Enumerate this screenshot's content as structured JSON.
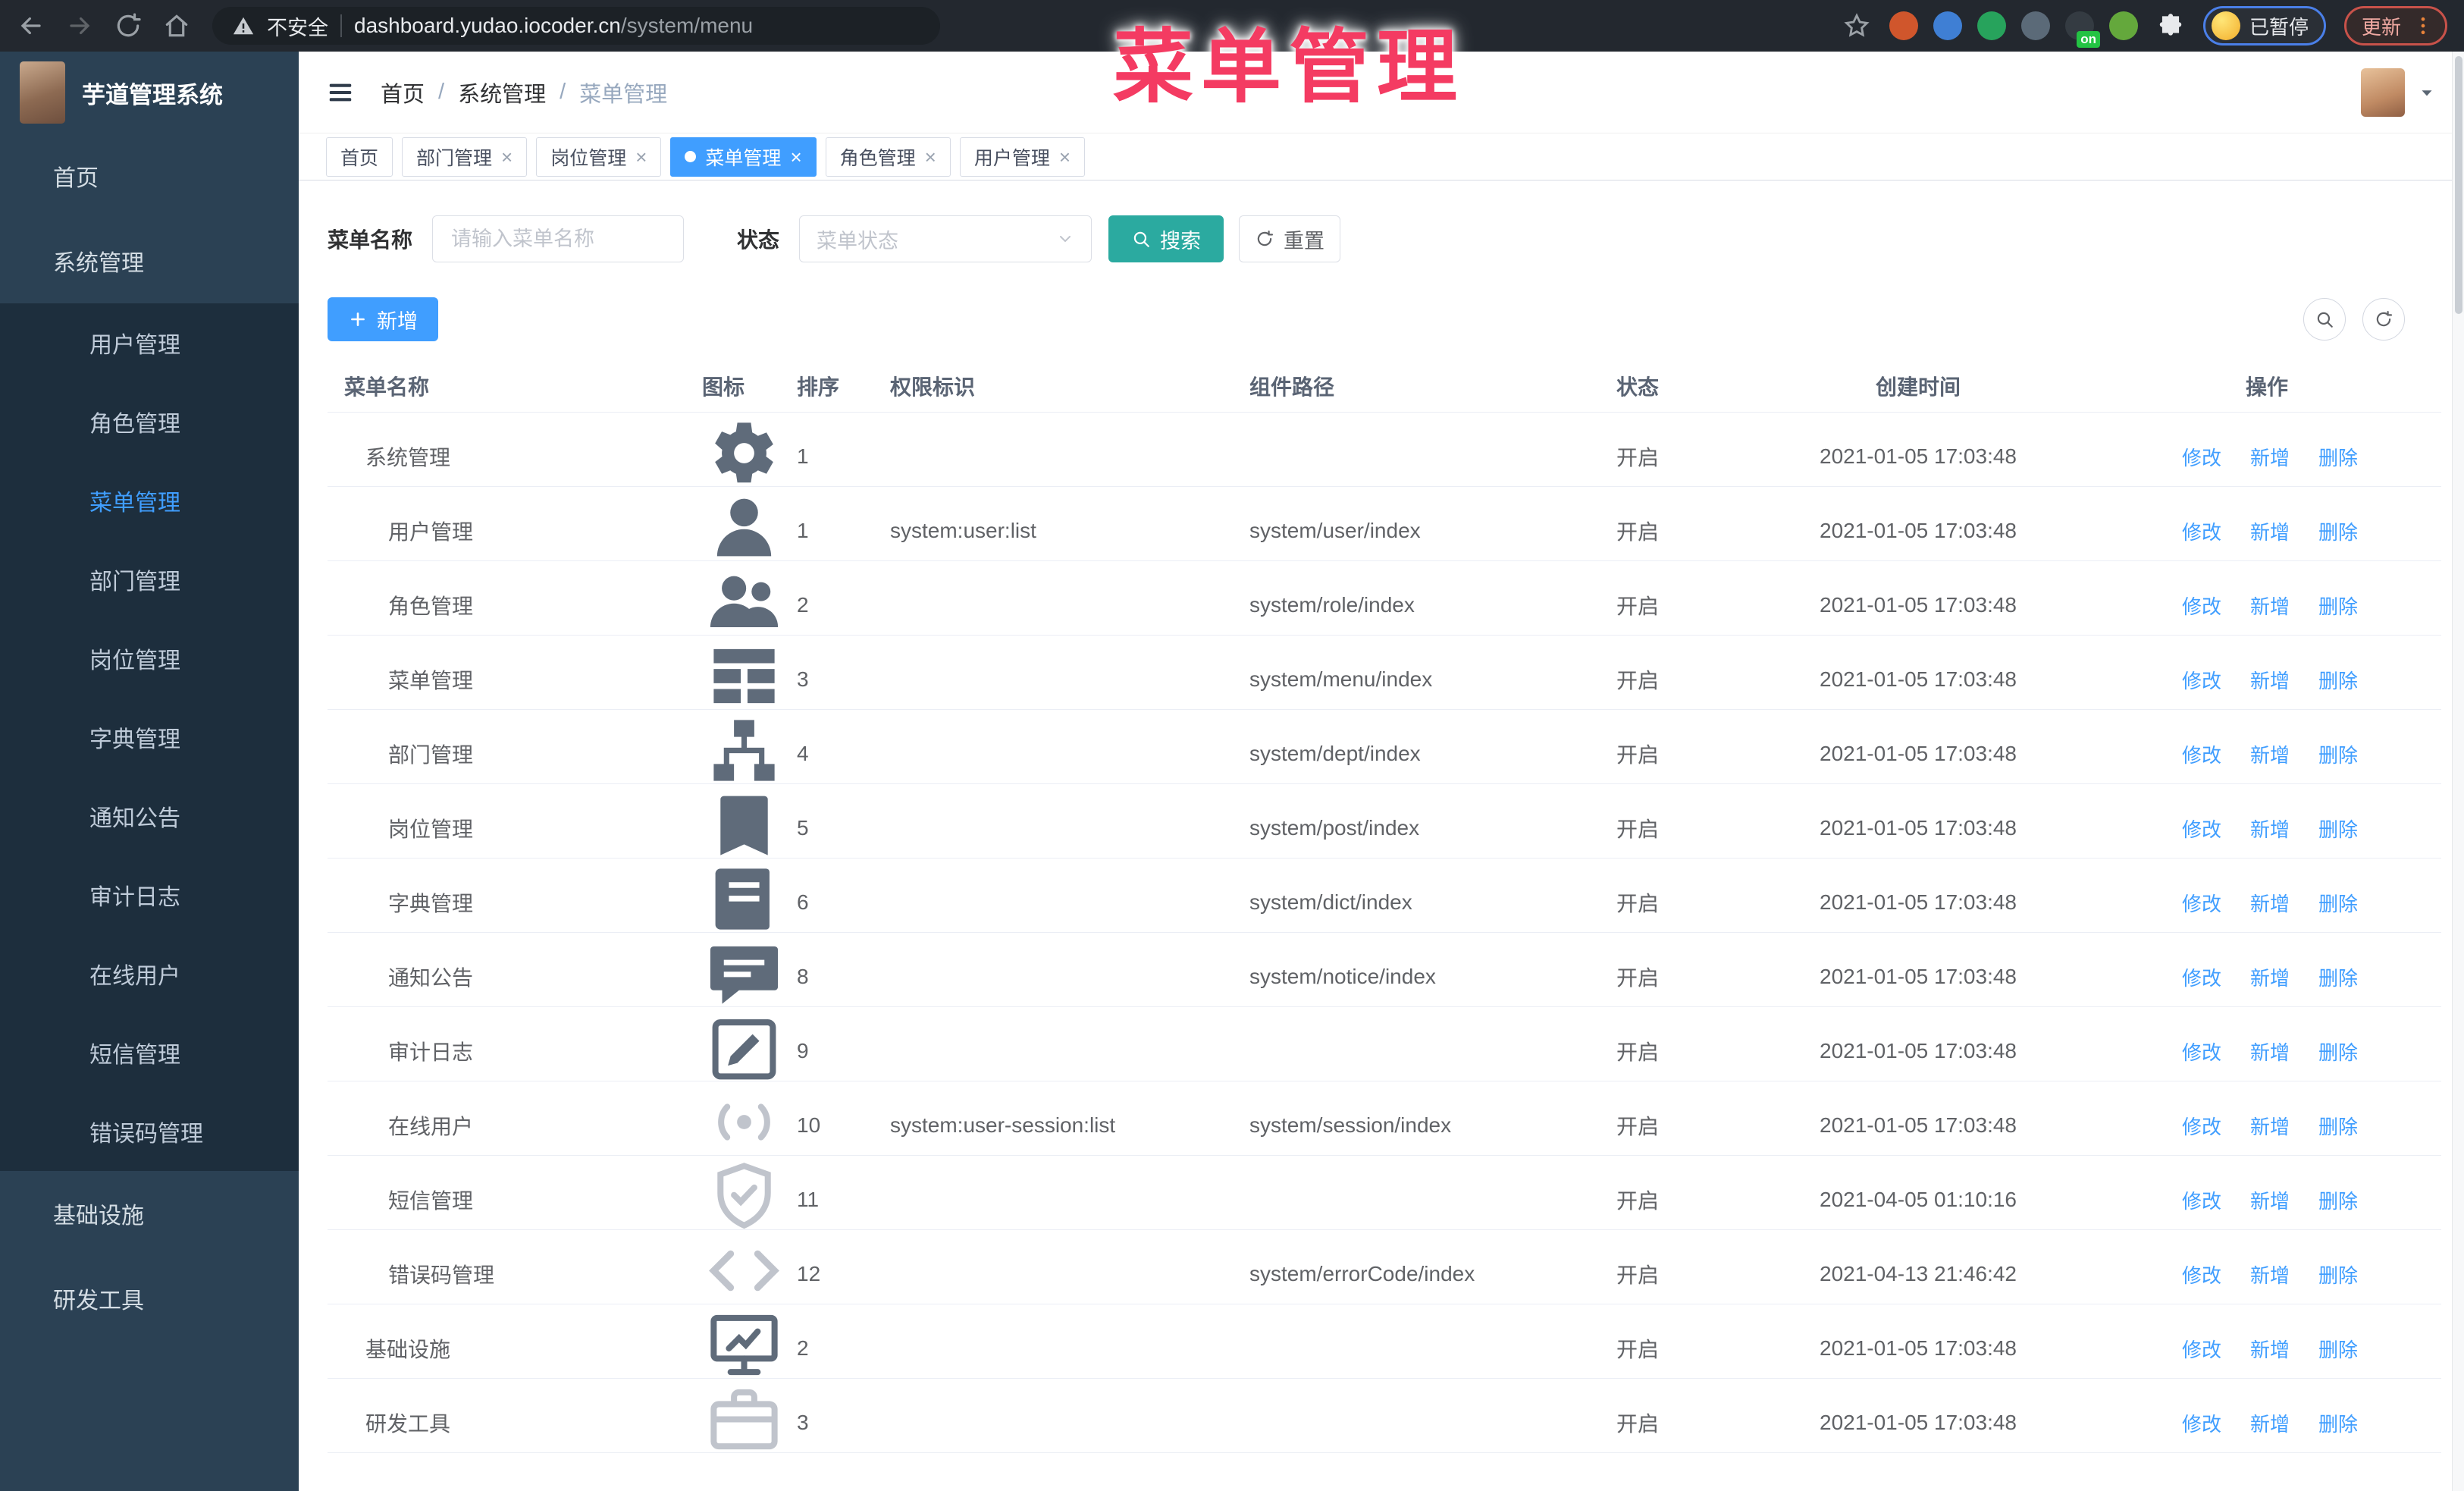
{
  "colors": {
    "accent": "#409eff",
    "teal": "#2baaa0",
    "overlay_pink": "#f43b62",
    "sidebar_bg": "#2b4154",
    "submenu_bg": "#1d2e3d",
    "chrome_bg": "#23282f"
  },
  "browser": {
    "security_label": "不安全",
    "url_host": "dashboard.yudao.iocoder.cn",
    "url_path": "/system/menu",
    "profile_label": "已暂停",
    "update_label": "更新",
    "extensions": [
      {
        "name": "extension-orange",
        "color": "#d0562c"
      },
      {
        "name": "extension-blue",
        "color": "#3f7fd4"
      },
      {
        "name": "extension-green-check",
        "color": "#27a35c"
      },
      {
        "name": "extension-slate",
        "color": "#5b6a78"
      },
      {
        "name": "extension-dark",
        "color": "#343b42",
        "badge": "on"
      },
      {
        "name": "extension-frog",
        "color": "#64a83c"
      }
    ]
  },
  "overlay": {
    "text": "菜单管理"
  },
  "app": {
    "title": "芋道管理系统"
  },
  "breadcrumb": [
    "首页",
    "系统管理",
    "菜单管理"
  ],
  "topbar_icons": [
    "search",
    "github",
    "help",
    "fullscreen",
    "fontsize"
  ],
  "tabs": [
    {
      "label": "首页",
      "closable": false,
      "active": false
    },
    {
      "label": "部门管理",
      "closable": true,
      "active": false
    },
    {
      "label": "岗位管理",
      "closable": true,
      "active": false
    },
    {
      "label": "菜单管理",
      "closable": true,
      "active": true
    },
    {
      "label": "角色管理",
      "closable": true,
      "active": false
    },
    {
      "label": "用户管理",
      "closable": true,
      "active": false
    }
  ],
  "sidebar": {
    "items": [
      {
        "label": "首页",
        "icon": "dashboard",
        "type": "root"
      },
      {
        "label": "系统管理",
        "icon": "gear",
        "type": "root",
        "chevron": "up"
      },
      {
        "label": "用户管理",
        "icon": "user",
        "type": "sub"
      },
      {
        "label": "角色管理",
        "icon": "users",
        "type": "sub"
      },
      {
        "label": "菜单管理",
        "icon": "menu",
        "type": "sub",
        "active": true
      },
      {
        "label": "部门管理",
        "icon": "tree",
        "type": "sub"
      },
      {
        "label": "岗位管理",
        "icon": "badge",
        "type": "sub"
      },
      {
        "label": "字典管理",
        "icon": "book",
        "type": "sub"
      },
      {
        "label": "通知公告",
        "icon": "chat",
        "type": "sub"
      },
      {
        "label": "审计日志",
        "icon": "edit",
        "type": "sub",
        "chevron": "down"
      },
      {
        "label": "在线用户",
        "icon": "online",
        "type": "sub"
      },
      {
        "label": "短信管理",
        "icon": "shield",
        "type": "sub",
        "chevron": "down"
      },
      {
        "label": "错误码管理",
        "icon": "code",
        "type": "sub"
      },
      {
        "label": "基础设施",
        "icon": "monitor",
        "type": "root",
        "chevron": "down"
      },
      {
        "label": "研发工具",
        "icon": "briefcase",
        "type": "root",
        "chevron": "down"
      }
    ]
  },
  "filters": {
    "name_label": "菜单名称",
    "name_placeholder": "请输入菜单名称",
    "name_value": "",
    "status_label": "状态",
    "status_placeholder": "菜单状态",
    "search_label": "搜索",
    "reset_label": "重置"
  },
  "toolbar": {
    "add_label": "新增"
  },
  "table": {
    "columns": [
      "菜单名称",
      "图标",
      "排序",
      "权限标识",
      "组件路径",
      "状态",
      "创建时间",
      "操作"
    ],
    "action_labels": {
      "edit": "修改",
      "add": "新增",
      "remove": "删除"
    },
    "rows": [
      {
        "name": "系统管理",
        "icon": "gear",
        "sort": "1",
        "perm": "",
        "path": "",
        "status": "开启",
        "time": "2021-01-05 17:03:48",
        "level": "root",
        "expanded": true
      },
      {
        "name": "用户管理",
        "icon": "user",
        "sort": "1",
        "perm": "system:user:list",
        "path": "system/user/index",
        "status": "开启",
        "time": "2021-01-05 17:03:48",
        "level": "child"
      },
      {
        "name": "角色管理",
        "icon": "users",
        "sort": "2",
        "perm": "",
        "path": "system/role/index",
        "status": "开启",
        "time": "2021-01-05 17:03:48",
        "level": "child"
      },
      {
        "name": "菜单管理",
        "icon": "menu",
        "sort": "3",
        "perm": "",
        "path": "system/menu/index",
        "status": "开启",
        "time": "2021-01-05 17:03:48",
        "level": "child"
      },
      {
        "name": "部门管理",
        "icon": "tree",
        "sort": "4",
        "perm": "",
        "path": "system/dept/index",
        "status": "开启",
        "time": "2021-01-05 17:03:48",
        "level": "child"
      },
      {
        "name": "岗位管理",
        "icon": "badge",
        "sort": "5",
        "perm": "",
        "path": "system/post/index",
        "status": "开启",
        "time": "2021-01-05 17:03:48",
        "level": "child"
      },
      {
        "name": "字典管理",
        "icon": "book",
        "sort": "6",
        "perm": "",
        "path": "system/dict/index",
        "status": "开启",
        "time": "2021-01-05 17:03:48",
        "level": "child"
      },
      {
        "name": "通知公告",
        "icon": "chat",
        "sort": "8",
        "perm": "",
        "path": "system/notice/index",
        "status": "开启",
        "time": "2021-01-05 17:03:48",
        "level": "child"
      },
      {
        "name": "审计日志",
        "icon": "edit",
        "sort": "9",
        "perm": "",
        "path": "",
        "status": "开启",
        "time": "2021-01-05 17:03:48",
        "level": "child"
      },
      {
        "name": "在线用户",
        "icon": "online",
        "sort": "10",
        "perm": "system:user-session:list",
        "path": "system/session/index",
        "status": "开启",
        "time": "2021-01-05 17:03:48",
        "level": "child"
      },
      {
        "name": "短信管理",
        "icon": "shield",
        "sort": "11",
        "perm": "",
        "path": "",
        "status": "开启",
        "time": "2021-04-05 01:10:16",
        "level": "child"
      },
      {
        "name": "错误码管理",
        "icon": "code",
        "sort": "12",
        "perm": "",
        "path": "system/errorCode/index",
        "status": "开启",
        "time": "2021-04-13 21:46:42",
        "level": "child"
      },
      {
        "name": "基础设施",
        "icon": "monitor",
        "sort": "2",
        "perm": "",
        "path": "",
        "status": "开启",
        "time": "2021-01-05 17:03:48",
        "level": "root"
      },
      {
        "name": "研发工具",
        "icon": "briefcase",
        "sort": "3",
        "perm": "",
        "path": "",
        "status": "开启",
        "time": "2021-01-05 17:03:48",
        "level": "root"
      }
    ]
  }
}
